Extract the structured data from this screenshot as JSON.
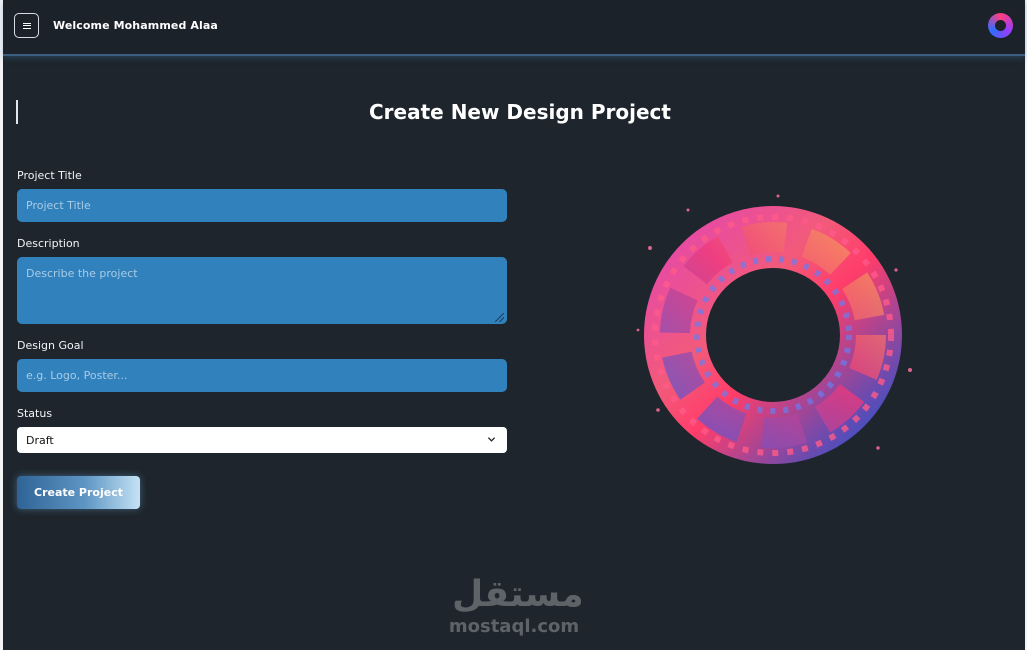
{
  "header": {
    "welcome_text": "Welcome Mohammed Alaa",
    "menu_icon": "hamburger-icon",
    "avatar_icon": "swirl-logo-avatar"
  },
  "form": {
    "title": "Create New Design Project",
    "project_title": {
      "label": "Project Title",
      "placeholder": "Project Title",
      "value": ""
    },
    "description": {
      "label": "Description",
      "placeholder": "Describe the project",
      "value": ""
    },
    "design_goal": {
      "label": "Design Goal",
      "placeholder": "e.g. Logo, Poster...",
      "value": ""
    },
    "status": {
      "label": "Status",
      "selected": "Draft"
    },
    "submit_label": "Create Project"
  },
  "colors": {
    "page_bg": "#1e252c",
    "input_bg": "#3181bd",
    "accent_pink": "#ff3d7f",
    "accent_blue": "#2f6dff"
  },
  "watermark": {
    "arabic": "مستقل",
    "latin": "mostaql.com"
  }
}
